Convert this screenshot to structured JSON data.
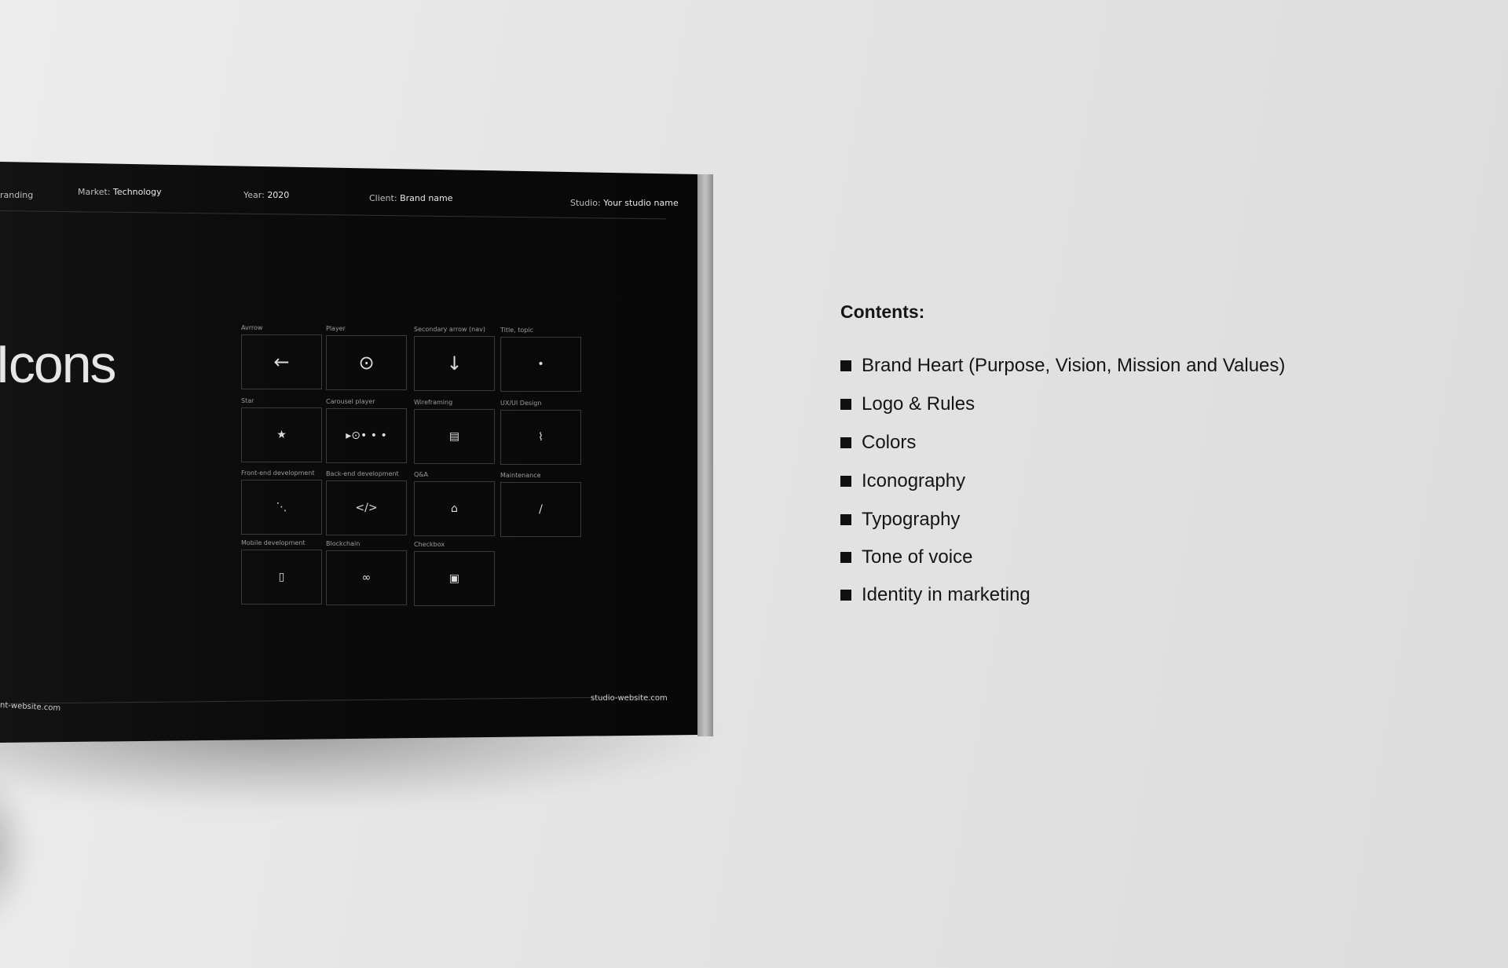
{
  "booklet": {
    "header": {
      "section_fragment": "randing",
      "market_label": "Market:",
      "market": "Technology",
      "year_label": "Year:",
      "year": "2020",
      "client_label": "Client:",
      "client": "Brand name",
      "studio_label": "Studio:",
      "studio": "Your studio name"
    },
    "title": "Icons",
    "icons": [
      {
        "label": "Avrrow",
        "icon": "arrow-left",
        "glyph": "←"
      },
      {
        "label": "Player",
        "icon": "play-circle",
        "glyph": "⊙"
      },
      {
        "label": "Secondary arrow (nav)",
        "icon": "arrow-down",
        "glyph": "↓"
      },
      {
        "label": "Title, topic",
        "icon": "dot",
        "glyph": "•"
      },
      {
        "label": "Star",
        "icon": "star",
        "glyph": "★"
      },
      {
        "label": "Carousel player",
        "icon": "carousel",
        "glyph": "▸⊙• • •"
      },
      {
        "label": "Wireframing",
        "icon": "wireframe",
        "glyph": "▤"
      },
      {
        "label": "UX/UI Design",
        "icon": "bezier",
        "glyph": "⌇"
      },
      {
        "label": "Front-end development",
        "icon": "nodes",
        "glyph": "⋱"
      },
      {
        "label": "Back-end development",
        "icon": "code",
        "glyph": "</>"
      },
      {
        "label": "Q&A",
        "icon": "bug",
        "glyph": "⌂"
      },
      {
        "label": "Maintenance",
        "icon": "pencil",
        "glyph": "/"
      },
      {
        "label": "Mobile development",
        "icon": "phone",
        "glyph": "▯"
      },
      {
        "label": "Blockchain",
        "icon": "chain",
        "glyph": "∞"
      },
      {
        "label": "Checkbox",
        "icon": "checkbox",
        "glyph": "▣"
      }
    ],
    "footer": {
      "left": "nt-website.com",
      "right": "studio-website.com"
    }
  },
  "contents": {
    "title": "Contents:",
    "items": [
      "Brand Heart (Purpose, Vision, Mission and Values)",
      "Logo & Rules",
      "Colors",
      "Iconography",
      "Typography",
      "Tone of voice",
      "Identity in marketing"
    ]
  }
}
